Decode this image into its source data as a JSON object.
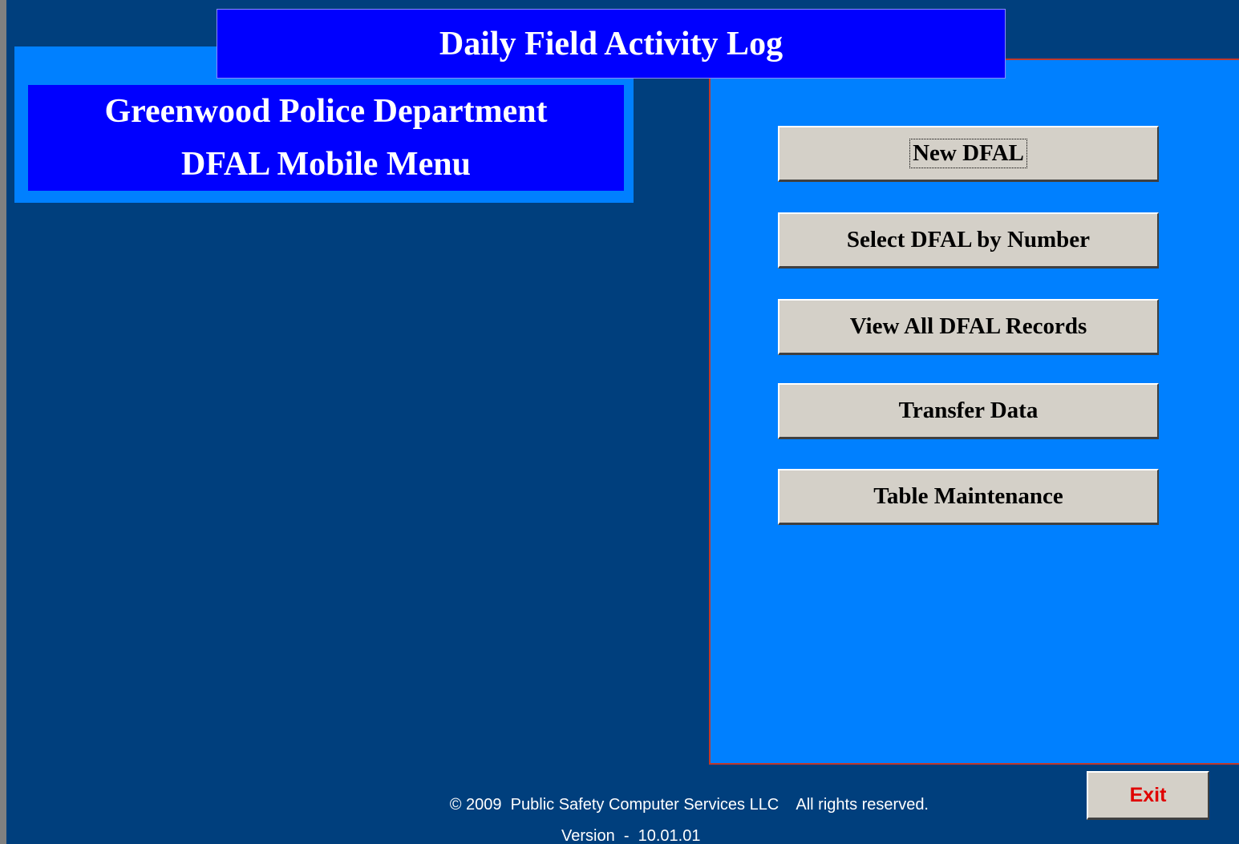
{
  "window": {
    "title": "Daily Field Activity Log"
  },
  "header": {
    "line1": "Greenwood Police Department",
    "line2": "DFAL Mobile Menu"
  },
  "menu": {
    "buttons": [
      {
        "label": "New DFAL",
        "focused": true
      },
      {
        "label": "Select DFAL by Number",
        "focused": false
      },
      {
        "label": "View All DFAL Records",
        "focused": false
      },
      {
        "label": "Transfer Data",
        "focused": false
      },
      {
        "label": "Table Maintenance",
        "focused": false
      }
    ]
  },
  "exit_button": {
    "label": "Exit"
  },
  "footer": {
    "copyright": "© 2009  Public Safety Computer Services LLC    All rights reserved.",
    "version": "Version  -  10.01.01"
  },
  "colors": {
    "background": "#003f7d",
    "title_bar": "#0000ff",
    "panel": "#0080ff",
    "button_face": "#d4d0c8",
    "exit_text": "#e00000",
    "panel_border": "#c0392b"
  }
}
